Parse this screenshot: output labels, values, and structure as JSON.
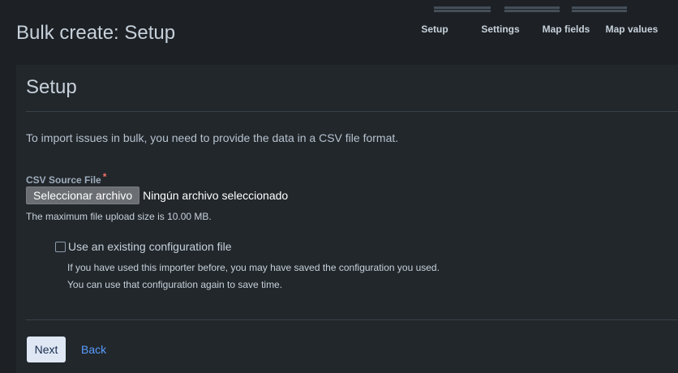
{
  "page": {
    "title": "Bulk create: Setup"
  },
  "tracker": {
    "steps": [
      {
        "label": "Setup"
      },
      {
        "label": "Settings"
      },
      {
        "label": "Map fields"
      },
      {
        "label": "Map values"
      }
    ]
  },
  "section": {
    "heading": "Setup",
    "intro": "To import issues in bulk, you need to provide the data in a CSV file format."
  },
  "file_field": {
    "label": "CSV Source File",
    "required_marker": "*",
    "button_label": "Seleccionar archivo",
    "status": "Ningún archivo seleccionado",
    "note": "The maximum file upload size is 10.00 MB."
  },
  "config": {
    "checkbox_label": "Use an existing configuration file",
    "checked": false,
    "help_line1": "If you have used this importer before, you may have saved the configuration you used.",
    "help_line2": "You can use that configuration again to save time."
  },
  "actions": {
    "next_label": "Next",
    "back_label": "Back"
  },
  "colors": {
    "background": "#1d2125",
    "panel": "#22272b",
    "link": "#579dff",
    "required": "#f87168",
    "primary_button": "#dfe7f5"
  }
}
